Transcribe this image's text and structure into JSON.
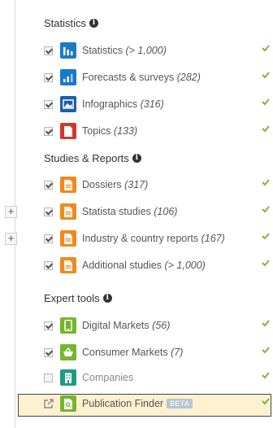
{
  "sections": {
    "statistics_title": "Statistics",
    "studies_title": "Studies & Reports",
    "expert_title": "Expert tools"
  },
  "colors": {
    "blue": "#1a7ac8",
    "dark_blue": "#1f5fa8",
    "red": "#d1382c",
    "orange": "#f08a1e",
    "green": "#74b62e",
    "teal": "#1f9a8a",
    "check_green": "#7cb83b",
    "highlight_bg": "#fdf1cf"
  },
  "statistics": [
    {
      "label": "Statistics",
      "count": "(> 1,000)",
      "icon": "bar-chart-icon",
      "checked": true
    },
    {
      "label": "Forecasts & surveys",
      "count": "(282)",
      "icon": "forecast-chart-icon",
      "checked": true
    },
    {
      "label": "Infographics",
      "count": "(316)",
      "icon": "picture-icon",
      "checked": true
    },
    {
      "label": "Topics",
      "count": "(133)",
      "icon": "document-icon",
      "checked": true
    }
  ],
  "studies": [
    {
      "label": "Dossiers",
      "count": "(317)",
      "icon": "document-icon",
      "checked": true,
      "expandable": false
    },
    {
      "label": "Statista studies",
      "count": "(106)",
      "icon": "document-icon",
      "checked": true,
      "expandable": true
    },
    {
      "label": "Industry & country reports",
      "count": "(167)",
      "icon": "document-icon",
      "checked": true,
      "expandable": true
    },
    {
      "label": "Additional studies",
      "count": "(> 1,000)",
      "icon": "document-icon",
      "checked": true,
      "expandable": false
    }
  ],
  "expert": [
    {
      "label": "Digital Markets",
      "count": "(56)",
      "icon": "mobile-icon",
      "checked": true
    },
    {
      "label": "Consumer Markets",
      "count": "(7)",
      "icon": "basket-icon",
      "checked": true
    },
    {
      "label": "Companies",
      "count": "",
      "icon": "building-icon",
      "checked": false
    }
  ],
  "publication_finder": {
    "label": "Publication Finder",
    "badge": "BETA",
    "icon": "search-doc-icon"
  },
  "expand_symbol": "+"
}
